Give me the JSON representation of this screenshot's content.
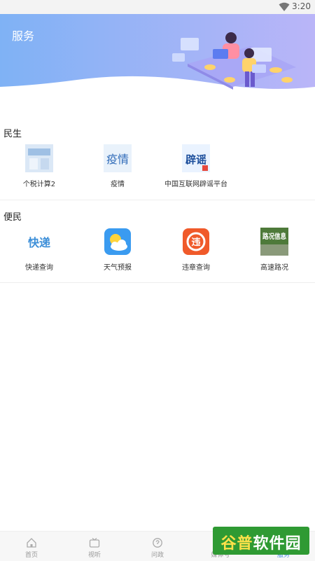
{
  "status_bar": {
    "time": "3:20"
  },
  "header": {
    "title": "服务"
  },
  "sections": [
    {
      "title": "民生",
      "items": [
        {
          "label": "个税计算2",
          "icon": "tax-calculator-icon"
        },
        {
          "label": "疫情",
          "icon": "epidemic-icon",
          "icon_text": "疫情"
        },
        {
          "label": "中国互联网辟谣平台",
          "icon": "rumor-refute-icon",
          "icon_text": "辟谣"
        }
      ]
    },
    {
      "title": "便民",
      "items": [
        {
          "label": "快递查询",
          "icon": "express-icon",
          "icon_text": "快递"
        },
        {
          "label": "天气预报",
          "icon": "weather-icon"
        },
        {
          "label": "违章查询",
          "icon": "violation-icon",
          "icon_text": "违"
        },
        {
          "label": "高速路况",
          "icon": "traffic-icon",
          "icon_text": "路况信息"
        }
      ]
    }
  ],
  "bottom_nav": [
    {
      "label": "首页",
      "icon": "home-icon"
    },
    {
      "label": "视听",
      "icon": "tv-icon"
    },
    {
      "label": "问政",
      "icon": "question-icon"
    },
    {
      "label": "媒体号",
      "icon": "media-icon"
    },
    {
      "label": "服务",
      "icon": "service-icon"
    }
  ],
  "watermark": {
    "text_a": "谷普",
    "text_b": "软件园"
  },
  "colors": {
    "banner_start": "#7fb2f5",
    "banner_end": "#b8b4f7",
    "accent": "#4a90e2"
  }
}
